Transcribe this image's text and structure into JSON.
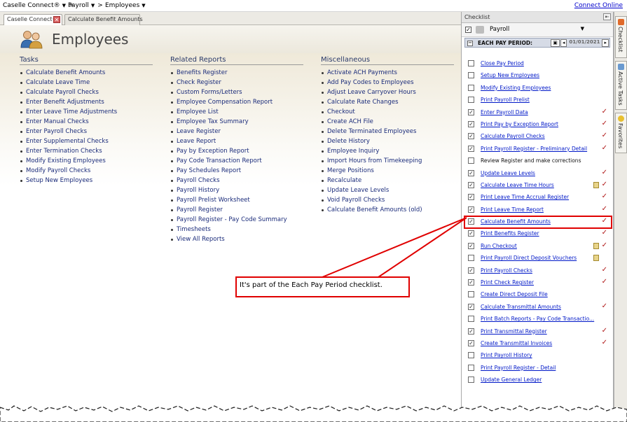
{
  "breadcrumb": {
    "items": [
      "Caselle Connect®",
      "Payroll",
      "Employees"
    ],
    "separator": ">",
    "connect_online": "Connect Online"
  },
  "tabs": [
    {
      "label": "Caselle Connect®",
      "active": true
    },
    {
      "label": "Calculate Benefit Amounts",
      "active": false
    }
  ],
  "page": {
    "title": "Employees"
  },
  "tasks": {
    "heading": "Tasks",
    "items": [
      "Calculate Benefit Amounts",
      "Calculate Leave Time",
      "Calculate Payroll Checks",
      "Enter Benefit Adjustments",
      "Enter Leave Time Adjustments",
      "Enter Manual Checks",
      "Enter Payroll Checks",
      "Enter Supplemental Checks",
      "Enter Termination Checks",
      "Modify Existing Employees",
      "Modify Payroll Checks",
      "Setup New Employees"
    ]
  },
  "reports": {
    "heading": "Related Reports",
    "items": [
      "Benefits Register",
      "Check Register",
      "Custom Forms/Letters",
      "Employee Compensation Report",
      "Employee List",
      "Employee Tax Summary",
      "Leave Register",
      "Leave Report",
      "Pay by Exception Report",
      "Pay Code Transaction Report",
      "Pay Schedules Report",
      "Payroll Checks",
      "Payroll History",
      "Payroll Prelist Worksheet",
      "Payroll Register",
      "Payroll Register - Pay Code Summary",
      "Timesheets",
      "View All Reports"
    ]
  },
  "misc": {
    "heading": "Miscellaneous",
    "items": [
      "Activate ACH Payments",
      "Add Pay Codes to Employees",
      "Adjust Leave Carryover Hours",
      "Calculate Rate Changes",
      "Checkout",
      "Create ACH File",
      "Delete Terminated Employees",
      "Delete History",
      "Employee Inquiry",
      "Import Hours from Timekeeping",
      "Merge Positions",
      "Recalculate",
      "Update Leave Levels",
      "Void Payroll Checks",
      "Calculate Benefit Amounts (old)"
    ]
  },
  "callout": {
    "text": "It's part of the Each Pay Period checklist."
  },
  "checklist": {
    "panel_title": "Checklist",
    "selected_list": "Payroll",
    "section_label": "EACH PAY PERIOD:",
    "section_date": "01/01/2021",
    "items": [
      {
        "label": "Close Pay Period",
        "checked": false,
        "done": false,
        "note": false,
        "link": true
      },
      {
        "label": "Setup New Employees",
        "checked": false,
        "done": false,
        "note": false,
        "link": true
      },
      {
        "label": "Modify Existing Employees",
        "checked": false,
        "done": false,
        "note": false,
        "link": true
      },
      {
        "label": "Print Payroll Prelist",
        "checked": false,
        "done": false,
        "note": false,
        "link": true
      },
      {
        "label": "Enter Payroll Data",
        "checked": true,
        "done": true,
        "note": false,
        "link": true
      },
      {
        "label": "Print Pay by Exception Report",
        "checked": true,
        "done": true,
        "note": false,
        "link": true
      },
      {
        "label": "Calculate Payroll Checks",
        "checked": true,
        "done": true,
        "note": false,
        "link": true
      },
      {
        "label": "Print Payroll Register - Preliminary Detail",
        "checked": true,
        "done": true,
        "note": false,
        "link": true
      },
      {
        "label": "Review Register and make corrections",
        "checked": false,
        "done": false,
        "note": false,
        "link": false
      },
      {
        "label": "Update Leave Levels",
        "checked": true,
        "done": true,
        "note": false,
        "link": true
      },
      {
        "label": "Calculate Leave Time Hours",
        "checked": true,
        "done": true,
        "note": true,
        "link": true
      },
      {
        "label": "Print Leave Time Accrual Register",
        "checked": true,
        "done": true,
        "note": false,
        "link": true
      },
      {
        "label": "Print Leave Time Report",
        "checked": true,
        "done": true,
        "note": false,
        "link": true
      },
      {
        "label": "Calculate Benefit Amounts",
        "checked": true,
        "done": true,
        "note": false,
        "link": true,
        "highlighted": true
      },
      {
        "label": "Print Benefits Register",
        "checked": true,
        "done": true,
        "note": false,
        "link": true
      },
      {
        "label": "Run Checkout",
        "checked": true,
        "done": true,
        "note": true,
        "link": true
      },
      {
        "label": "Print Payroll Direct Deposit Vouchers",
        "checked": false,
        "done": false,
        "note": true,
        "link": true
      },
      {
        "label": "Print Payroll Checks",
        "checked": true,
        "done": true,
        "note": false,
        "link": true
      },
      {
        "label": "Print Check Register",
        "checked": true,
        "done": true,
        "note": false,
        "link": true
      },
      {
        "label": "Create Direct Deposit File",
        "checked": false,
        "done": false,
        "note": false,
        "link": true
      },
      {
        "label": "Calculate Transmittal Amounts",
        "checked": true,
        "done": true,
        "note": false,
        "link": true
      },
      {
        "label": "Print Batch Reports - Pay Code Transactio...",
        "checked": false,
        "done": false,
        "note": false,
        "link": true
      },
      {
        "label": "Print Transmittal Register",
        "checked": true,
        "done": true,
        "note": false,
        "link": true
      },
      {
        "label": "Create Transmittal Invoices",
        "checked": true,
        "done": true,
        "note": false,
        "link": true
      },
      {
        "label": "Print Payroll History",
        "checked": false,
        "done": false,
        "note": false,
        "link": true
      },
      {
        "label": "Print Payroll Register - Detail",
        "checked": false,
        "done": false,
        "note": false,
        "link": true
      },
      {
        "label": "Update General Ledger",
        "checked": false,
        "done": false,
        "note": false,
        "link": true
      }
    ]
  },
  "side_tabs": [
    {
      "label": "Checklist",
      "icon": "checklist-icon"
    },
    {
      "label": "Active Tasks",
      "icon": "tasks-icon"
    },
    {
      "label": "Favorites",
      "icon": "star-icon"
    }
  ],
  "colors": {
    "link": "#1a2b7a",
    "checklist_link": "#0018c8",
    "highlight": "#e00000",
    "done_tick": "#b01818"
  }
}
